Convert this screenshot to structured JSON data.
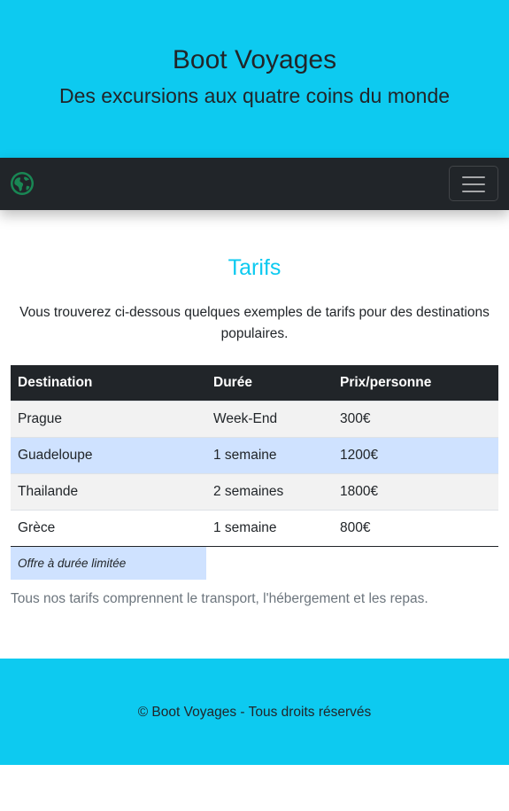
{
  "header": {
    "title": "Boot Voyages",
    "subtitle": "Des excursions aux quatre coins du monde"
  },
  "navbar": {
    "brand_icon": "globe-icon",
    "toggler_icon": "hamburger-menu-icon"
  },
  "pricing": {
    "title": "Tarifs",
    "intro": "Vous trouverez ci-dessous quelques exemples de tarifs pour des destinations populaires.",
    "columns": [
      "Destination",
      "Durée",
      "Prix/personne"
    ],
    "rows": [
      [
        "Prague",
        "Week-End",
        "300€"
      ],
      [
        "Guadeloupe",
        "1 semaine",
        "1200€"
      ],
      [
        "Thailande",
        "2 semaines",
        "1800€"
      ],
      [
        "Grèce",
        "1 semaine",
        "800€"
      ]
    ],
    "footnote": "Offre à durée limitée",
    "note": "Tous nos tarifs comprennent le transport, l'hébergement et les repas."
  },
  "footer": {
    "copyright": "© Boot Voyages - Tous droits réservés"
  },
  "colors": {
    "accent": "#0dcaf0",
    "navbar": "#212529",
    "highlight_row": "#cfe2ff",
    "striped_row": "#f2f2f2",
    "brand_icon": "#198754"
  }
}
